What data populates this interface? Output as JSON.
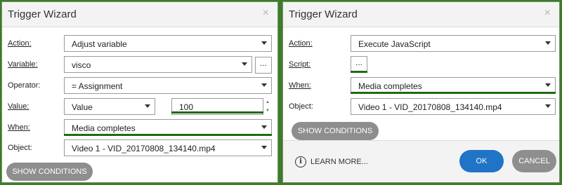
{
  "left": {
    "title": "Trigger Wizard",
    "close": "×",
    "labels": {
      "action": "Action:",
      "variable": "Variable:",
      "operator": "Operator:",
      "value": "Value:",
      "when": "When:",
      "object": "Object:"
    },
    "action_value": "Adjust variable",
    "variable_value": "visco",
    "variable_more": "...",
    "operator_value": "= Assignment",
    "value_type": "Value",
    "value_number": "100",
    "when_value": "Media completes",
    "object_value": "Video 1 - VID_20170808_134140.mp4",
    "show_conditions": "SHOW CONDITIONS"
  },
  "right": {
    "title": "Trigger Wizard",
    "close": "×",
    "labels": {
      "action": "Action:",
      "script": "Script:",
      "when": "When:",
      "object": "Object:"
    },
    "action_value": "Execute JavaScript",
    "script_more": "...",
    "when_value": "Media completes",
    "object_value": "Video 1 - VID_20170808_134140.mp4",
    "show_conditions": "SHOW CONDITIONS",
    "learn_more": "LEARN MORE...",
    "info_glyph": "i",
    "ok": "OK",
    "cancel": "CANCEL"
  },
  "colors": {
    "accent_green": "#1f6b12",
    "ok_blue": "#1f74c6",
    "gray_button": "#8e8e8e"
  }
}
